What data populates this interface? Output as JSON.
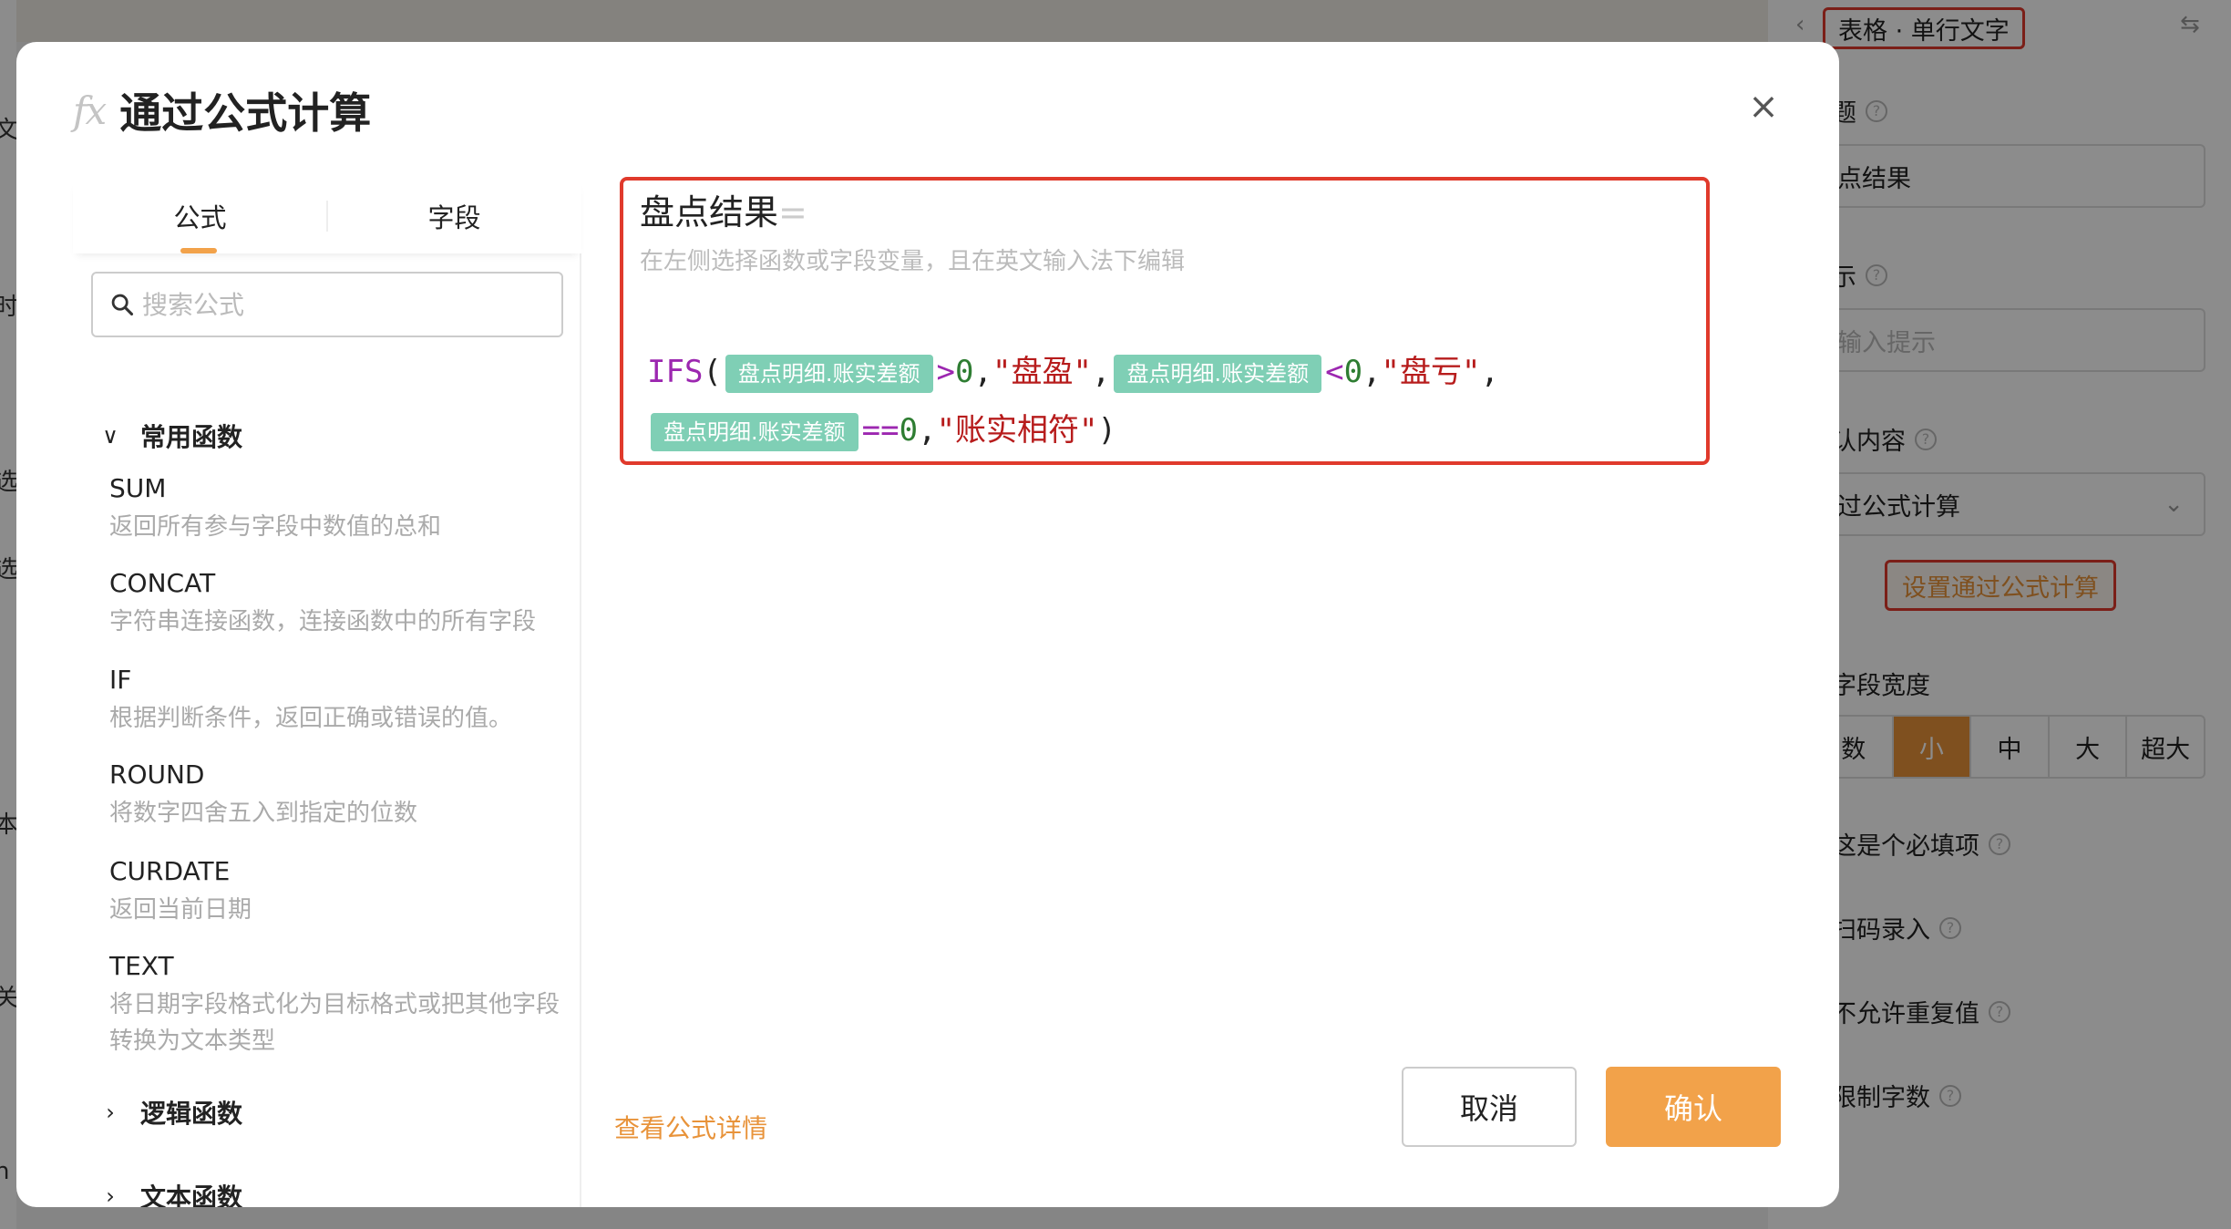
{
  "background": {
    "left_edge_glyphs": [
      "文",
      "时",
      "选",
      "选",
      "本",
      "关",
      "n"
    ],
    "right_panel": {
      "breadcrumb": "表格 · 单行文字",
      "label_title": "题",
      "title_value": "点结果",
      "label_hint": "示",
      "hint_placeholder": "输入提示",
      "label_default": "认内容",
      "default_select": "过公式计算",
      "set_formula_button": "设置通过公式计算",
      "label_width": "字段宽度",
      "width_options": [
        "数",
        "小",
        "中",
        "大",
        "超大"
      ],
      "width_selected": "小",
      "option_required": "这是个必填项",
      "option_scan": "扫码录入",
      "option_unique": "不允许重复值",
      "option_limit": "限制字数"
    }
  },
  "modal": {
    "title": "通过公式计算",
    "fx_icon_glyph": "fx",
    "close_glyph": "×",
    "tabs": [
      "公式",
      "字段"
    ],
    "active_tab": "公式",
    "search_placeholder": "搜索公式",
    "groups": {
      "common": {
        "label": "常用函数",
        "expanded": true
      },
      "logic": {
        "label": "逻辑函数",
        "expanded": false
      },
      "text": {
        "label": "文本函数",
        "expanded": false
      }
    },
    "functions": [
      {
        "name": "SUM",
        "desc": "返回所有参与字段中数值的总和"
      },
      {
        "name": "CONCAT",
        "desc": "字符串连接函数，连接函数中的所有字段"
      },
      {
        "name": "IF",
        "desc": "根据判断条件，返回正确或错误的值。"
      },
      {
        "name": "ROUND",
        "desc": "将数字四舍五入到指定的位数"
      },
      {
        "name": "CURDATE",
        "desc": "返回当前日期"
      },
      {
        "name": "TEXT",
        "desc": "将日期字段格式化为目标格式或把其他字段转换为文本类型"
      }
    ],
    "editor": {
      "field_name": "盘点结果",
      "equals": "=",
      "hint": "在左侧选择函数或字段变量，且在英文输入法下编辑",
      "formula": {
        "fn": "IFS",
        "open": "(",
        "field_chip": "盘点明细.账实差额",
        "op_gt": ">",
        "op_lt": "<",
        "op_eq": "==",
        "zero": "0",
        "comma": ",",
        "str_profit": "\"盘盈\"",
        "str_loss": "\"盘亏\"",
        "str_match": "\"账实相符\"",
        "close": ")"
      }
    },
    "detail_link": "查看公式详情",
    "cancel_button": "取消",
    "confirm_button": "确认"
  },
  "colors": {
    "accent": "#f2a24a",
    "highlight_border": "#e03a2c",
    "chip": "#7fcfb5",
    "keyword": "#9c27b0",
    "string": "#b71c1c",
    "number": "#2e7d32"
  }
}
